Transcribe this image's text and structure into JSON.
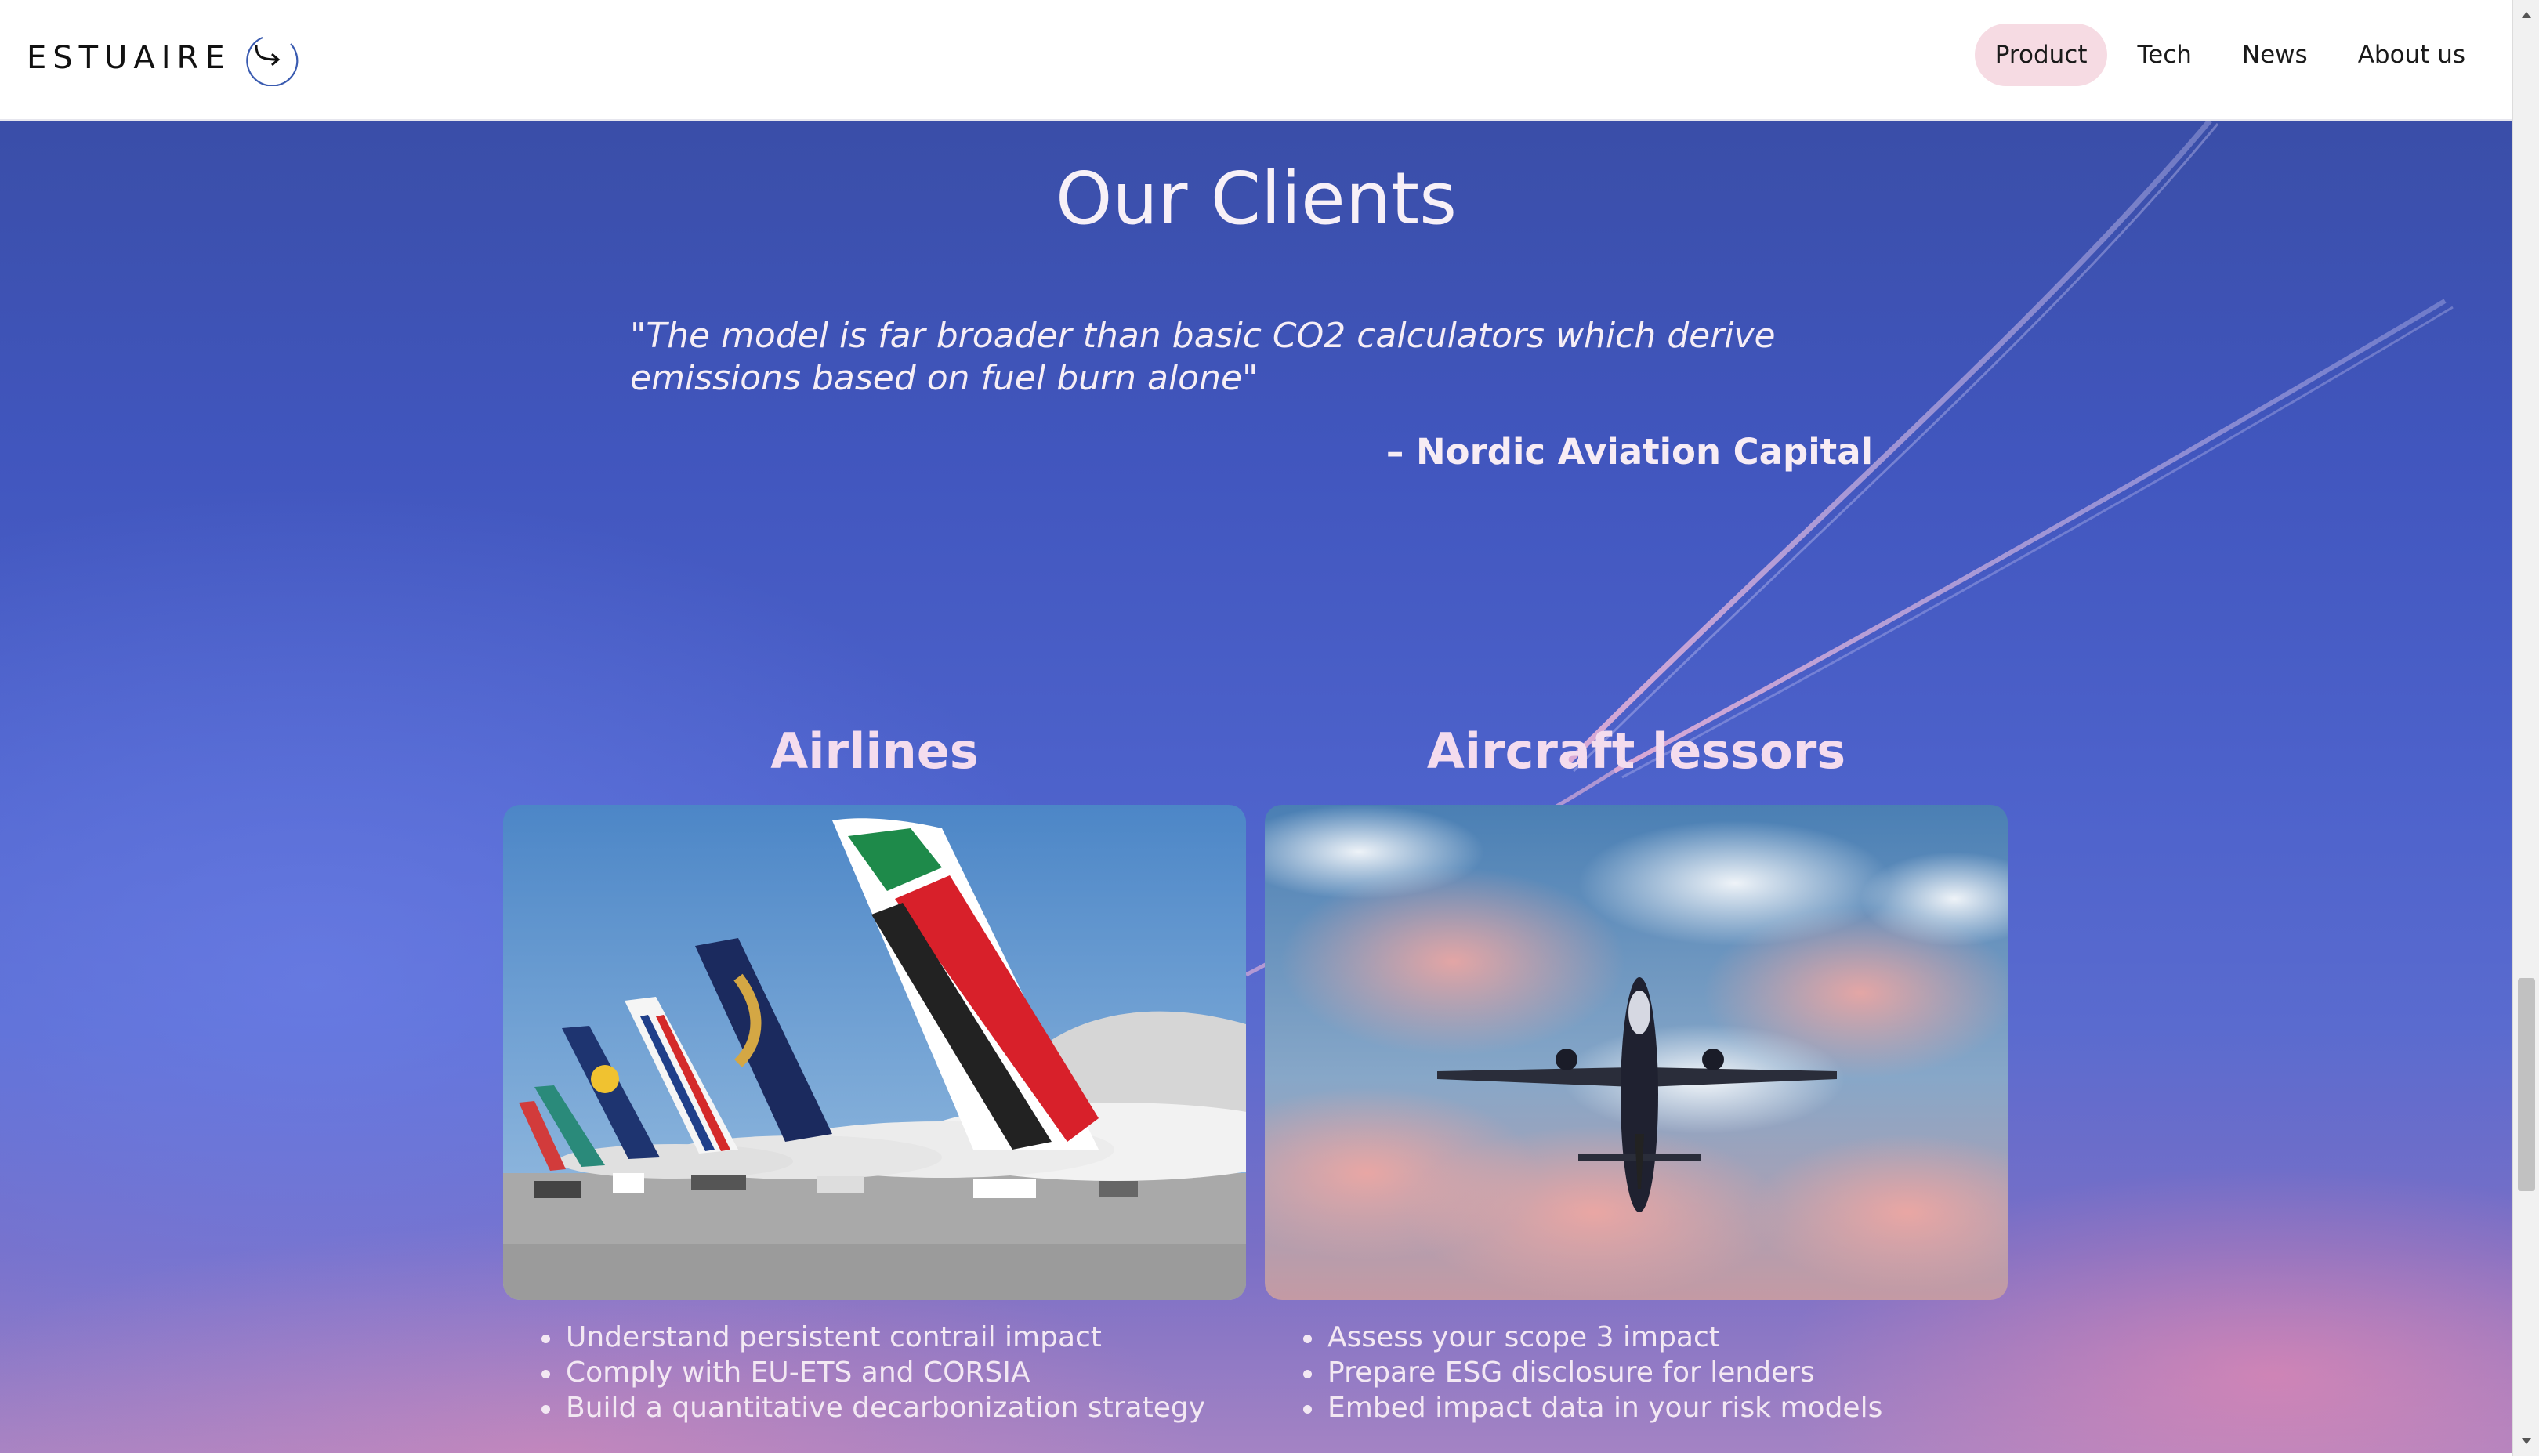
{
  "header": {
    "logo_text": "ESTUAIRE",
    "nav": [
      {
        "label": "Product",
        "active": true
      },
      {
        "label": "Tech",
        "active": false
      },
      {
        "label": "News",
        "active": false
      },
      {
        "label": "About us",
        "active": false
      }
    ]
  },
  "clients": {
    "title": "Our Clients",
    "quote": "\"The model is far broader than basic CO2 calculators which derive emissions based on fuel burn alone\"",
    "quote_author": "– Nordic Aviation Capital"
  },
  "cards": [
    {
      "title": "Airlines",
      "image": "airline-tails-photo",
      "bullets": [
        "Understand persistent contrail impact",
        "Comply with EU-ETS and CORSIA",
        "Build a quantitative decarbonization strategy"
      ]
    },
    {
      "title": "Aircraft lessors",
      "image": "plane-sunset-sky-photo",
      "bullets": [
        "Assess your scope 3 impact",
        "Prepare ESG disclosure for lenders",
        "Embed impact data in your risk models"
      ]
    }
  ],
  "colors": {
    "nav_active_bg": "#f6dbe3",
    "sky_top": "#3a4ea8",
    "sky_bottom": "#a483c4",
    "card_title": "#f4dcee"
  },
  "icons": {
    "logo_mark": "circle-arrow-icon",
    "scroll_up": "triangle-up-icon",
    "scroll_down": "triangle-down-icon"
  }
}
